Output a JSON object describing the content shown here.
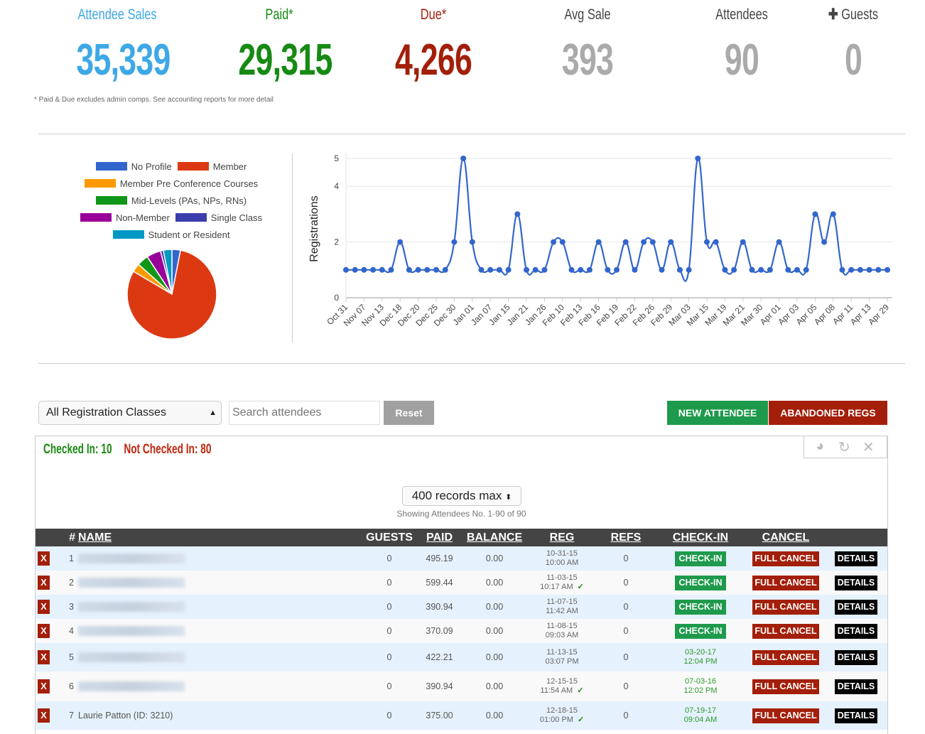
{
  "stats": [
    {
      "label": "Attendee Sales",
      "value": "35,339",
      "color": "#3ea8e6"
    },
    {
      "label": "Paid*",
      "value": "29,315",
      "color": "#168a12"
    },
    {
      "label": "Due*",
      "value": "4,266",
      "color": "#a31f0a"
    },
    {
      "label": "Avg Sale",
      "value": "393",
      "color": "#aaaaaa"
    },
    {
      "label": "Attendees",
      "value": "90",
      "color": "#aaaaaa"
    },
    {
      "label": "Guests",
      "value": "0",
      "color": "#aaaaaa",
      "icon": "plus-icon"
    }
  ],
  "footnote": "* Paid & Due excludes admin comps. See accounting reports for more detail",
  "chart_data": [
    {
      "type": "pie",
      "title": "",
      "legend_position": "top",
      "labels": [
        "No Profile",
        "Member",
        "Member Pre Conference Courses",
        "Mid-Levels (PAs, NPs, RNs)",
        "Non-Member",
        "Single Class",
        "Student or Resident"
      ],
      "colors": [
        "#3366cc",
        "#dc3912",
        "#ff9900",
        "#109618",
        "#990099",
        "#3b3eac",
        "#0099c6"
      ],
      "values": [
        3,
        78,
        3,
        4,
        5,
        1,
        3
      ]
    },
    {
      "type": "line",
      "title": "",
      "xlabel": "",
      "ylabel": "Registrations",
      "ylim": [
        0,
        5
      ],
      "yticks": [
        0,
        2,
        4,
        5
      ],
      "grid": true,
      "color": "#3366cc",
      "tick_labels": [
        "Oct 31",
        "Nov 07",
        "Nov 13",
        "Dec 18",
        "Dec 20",
        "Dec 25",
        "Dec 30",
        "Jan 01",
        "Jan 07",
        "Jan 15",
        "Jan 21",
        "Jan 26",
        "Feb 10",
        "Feb 13",
        "Feb 16",
        "Feb 19",
        "Feb 22",
        "Feb 26",
        "Feb 29",
        "Mar 03",
        "Mar 15",
        "Mar 19",
        "Mar 21",
        "Mar 30",
        "Apr 01",
        "Apr 03",
        "Apr 05",
        "Apr 08",
        "Apr 11",
        "Apr 13",
        "Apr 29"
      ],
      "values": [
        1,
        1,
        1,
        1,
        1,
        1,
        2,
        1,
        1,
        1,
        1,
        1,
        2,
        5,
        2,
        1,
        1,
        1,
        1,
        3,
        1,
        1,
        1,
        2,
        2,
        1,
        1,
        1,
        2,
        1,
        1,
        2,
        1,
        2,
        2,
        1,
        2,
        1,
        1,
        5,
        2,
        2,
        1,
        1,
        2,
        1,
        1,
        1,
        2,
        1,
        1,
        1,
        3,
        2,
        3,
        1,
        1,
        1,
        1,
        1,
        1
      ]
    }
  ],
  "controls": {
    "class_select": "All Registration Classes",
    "search_placeholder": "Search attendees",
    "reset_label": "Reset",
    "new_attendee_label": "NEW ATTENDEE",
    "abandoned_label": "ABANDONED REGS"
  },
  "panel": {
    "checked_in": "Checked In: 10",
    "not_checked_in": "Not Checked In: 80",
    "records_select": "400 records max",
    "showing": "Showing Attendees No. 1-90 of 90"
  },
  "table": {
    "headers": {
      "num": "#",
      "name": "NAME",
      "guests": "GUESTS",
      "paid": "PAID",
      "balance": "BALANCE",
      "reg": "REG",
      "refs": "REFS",
      "checkin": "CHECK-IN",
      "cancel": "CANCEL"
    },
    "x_label": "X",
    "checkin_label": "CHECK-IN",
    "cancel_label": "FULL CANCEL",
    "details_label": "DETAILS",
    "rows": [
      {
        "num": "1",
        "name": "",
        "blurred": true,
        "guests": "0",
        "paid": "495.19",
        "balance": "0.00",
        "reg_date": "10-31-15",
        "reg_time": "10:00 AM",
        "reg_check": false,
        "refs": "0",
        "checkin_date": "",
        "checkin_time": ""
      },
      {
        "num": "2",
        "name": "",
        "blurred": true,
        "guests": "0",
        "paid": "599.44",
        "balance": "0.00",
        "reg_date": "11-03-15",
        "reg_time": "10:17 AM",
        "reg_check": true,
        "refs": "0",
        "checkin_date": "",
        "checkin_time": ""
      },
      {
        "num": "3",
        "name": "",
        "blurred": true,
        "guests": "0",
        "paid": "390.94",
        "balance": "0.00",
        "reg_date": "11-07-15",
        "reg_time": "11:42 AM",
        "reg_check": false,
        "refs": "0",
        "checkin_date": "",
        "checkin_time": ""
      },
      {
        "num": "4",
        "name": "",
        "blurred": true,
        "guests": "0",
        "paid": "370.09",
        "balance": "0.00",
        "reg_date": "11-08-15",
        "reg_time": "09:03 AM",
        "reg_check": false,
        "refs": "0",
        "checkin_date": "",
        "checkin_time": ""
      },
      {
        "num": "5",
        "name": "",
        "blurred": true,
        "guests": "0",
        "paid": "422.21",
        "balance": "0.00",
        "reg_date": "11-13-15",
        "reg_time": "03:07 PM",
        "reg_check": false,
        "refs": "0",
        "checkin_date": "03-20-17",
        "checkin_time": "12:04 PM"
      },
      {
        "num": "6",
        "name": "",
        "blurred": true,
        "guests": "0",
        "paid": "390.94",
        "balance": "0.00",
        "reg_date": "12-15-15",
        "reg_time": "11:54 AM",
        "reg_check": true,
        "refs": "0",
        "checkin_date": "07-03-16",
        "checkin_time": "12:02 PM"
      },
      {
        "num": "7",
        "name": "Laurie Patton (ID: 3210)",
        "blurred": false,
        "guests": "0",
        "paid": "375.00",
        "balance": "0.00",
        "reg_date": "12-18-15",
        "reg_time": "01:00 PM",
        "reg_check": true,
        "refs": "0",
        "checkin_date": "07-19-17",
        "checkin_time": "09:04 AM"
      }
    ]
  }
}
